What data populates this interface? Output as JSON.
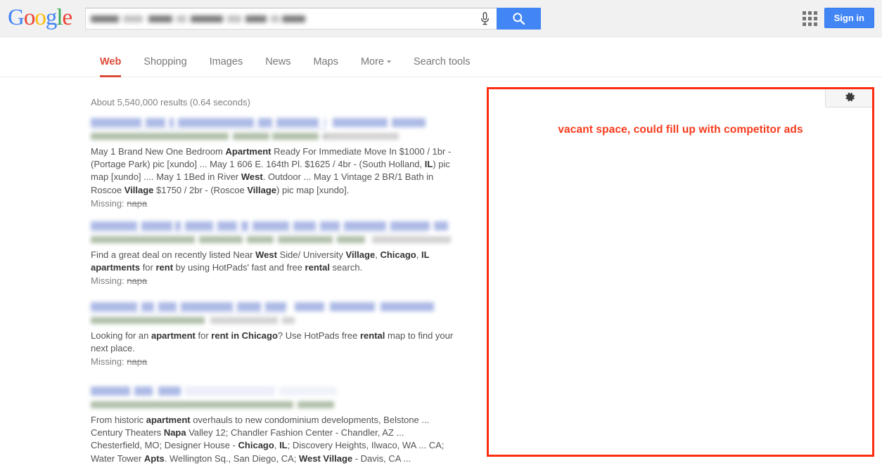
{
  "header": {
    "logo_letters": [
      {
        "ch": "G",
        "color": "#4285f4"
      },
      {
        "ch": "o",
        "color": "#ea4335"
      },
      {
        "ch": "o",
        "color": "#fbbc05"
      },
      {
        "ch": "g",
        "color": "#4285f4"
      },
      {
        "ch": "l",
        "color": "#34a853"
      },
      {
        "ch": "e",
        "color": "#ea4335"
      }
    ],
    "search_value": "",
    "search_placeholder": "",
    "search_redacted": true,
    "mic_icon": "microphone-icon",
    "search_icon": "search-icon",
    "apps_icon": "apps-grid-icon",
    "sign_in_label": "Sign in",
    "accent_blue": "#4285f4"
  },
  "nav": {
    "items": [
      {
        "label": "Web",
        "active": true,
        "has_caret": false
      },
      {
        "label": "Shopping",
        "active": false,
        "has_caret": false
      },
      {
        "label": "Images",
        "active": false,
        "has_caret": false
      },
      {
        "label": "News",
        "active": false,
        "has_caret": false
      },
      {
        "label": "Maps",
        "active": false,
        "has_caret": false
      },
      {
        "label": "More",
        "active": false,
        "has_caret": true
      },
      {
        "label": "Search tools",
        "active": false,
        "has_caret": false
      }
    ],
    "active_color": "#dd4b39",
    "settings_icon": "gear-icon"
  },
  "results": {
    "count_text": "About 5,540,000 results (0.64 seconds)",
    "items": [
      {
        "title_redacted": true,
        "url_redacted": true,
        "snippet_html": "May 1 Brand New One Bedroom <b>Apartment</b> Ready For Immediate Move In $1000 / 1br - (Portage Park) pic [xundo] ... May 1 606 E. 164th Pl. $1625 / 4br - (South Holland, <b>IL</b>) pic map [xundo] .... May 1 1Bed in River <b>West</b>. Outdoor ... May 1 Vintage 2 BR/1 Bath in Roscoe <b>Village</b> $1750 / 2br - (Roscoe <b>Village</b>) pic map [xundo].",
        "missing_prefix": "Missing: ",
        "missing_term": "napa"
      },
      {
        "title_redacted": true,
        "url_redacted": true,
        "snippet_html": "Find a great deal on recently listed Near <b>West</b> Side/ University <b>Village</b>, <b>Chicago</b>, <b>IL</b> <b>apartments</b> for <b>rent</b> by using HotPads' fast and free <b>rental</b> search.",
        "missing_prefix": "Missing: ",
        "missing_term": "napa"
      },
      {
        "title_redacted": true,
        "url_redacted": true,
        "snippet_html": "Looking for an <b>apartment</b> for <b>rent in Chicago</b>? Use HotPads free <b>rental</b> map to find your next place.",
        "missing_prefix": "Missing: ",
        "missing_term": "napa"
      },
      {
        "title_redacted": true,
        "url_redacted": true,
        "snippet_html": "From historic <b>apartment</b> overhauls to new condominium developments, Belstone ... Century Theaters <b>Napa</b> Valley 12; Chandler Fashion Center - Chandler, AZ ... Chesterfield, MO; Designer House - <b>Chicago</b>, <b>IL</b>; Discovery Heights, Ilwaco, WA ... CA; Water Tower <b>Apts</b>. Wellington Sq., San Diego, CA; <b>West Village</b> - Davis, CA ...",
        "missing_prefix": "",
        "missing_term": ""
      }
    ]
  },
  "annotation": {
    "text": "vacant space, could fill up with competitor ads",
    "border_color": "#ff2d0f",
    "text_color": "#f73a1c"
  }
}
